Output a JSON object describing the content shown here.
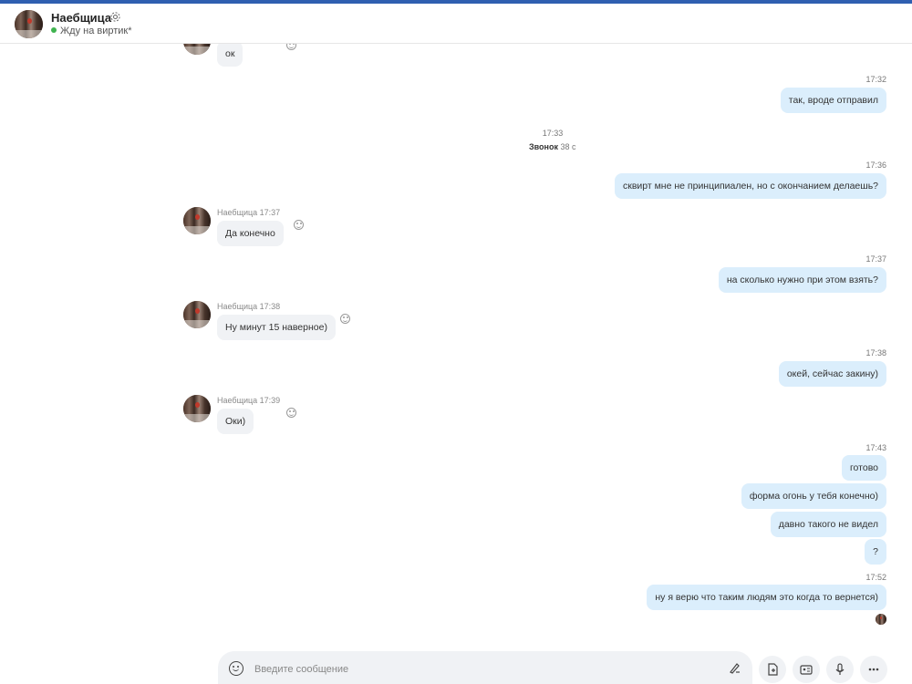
{
  "header": {
    "contact_name": "Наебщица",
    "status": "Жду на виртик*"
  },
  "messages": {
    "in_0_text": "ок",
    "out_1_time": "17:32",
    "out_1_text": "так, вроде отправил",
    "call_time": "17:33",
    "call_label": "Звонок",
    "call_duration": "38 с",
    "out_2_time": "17:36",
    "out_2_text": "сквирт мне не принципиален, но с окончанием делаешь?",
    "in_1_meta": "Наебщица 17:37",
    "in_1_text": "Да конечно",
    "out_3_time": "17:37",
    "out_3_text": "на сколько нужно при этом взять?",
    "in_2_meta": "Наебщица 17:38",
    "in_2_text": "Ну минут 15 наверное)",
    "out_4_time": "17:38",
    "out_4_text": "окей, сейчас закину)",
    "in_3_meta": "Наебщица 17:39",
    "in_3_text": "Оки)",
    "out_5_time": "17:43",
    "out_5_texts": [
      "готово",
      "форма огонь у тебя конечно)",
      "давно такого не видел",
      "?"
    ],
    "out_6_time": "17:52",
    "out_6_text": "ну я верю что таким людям это когда то вернется)"
  },
  "composer": {
    "placeholder": "Введите сообщение"
  },
  "icons": {
    "settings": "gear-icon",
    "emoji": "smile-icon",
    "pen": "pen-icon",
    "file": "file-icon",
    "contact_card": "contact-card-icon",
    "mic": "microphone-icon",
    "more": "more-icon"
  },
  "colors": {
    "outgoing_bubble": "#dbeefc",
    "incoming_bubble": "#f0f2f5",
    "online": "#3fb34f"
  }
}
